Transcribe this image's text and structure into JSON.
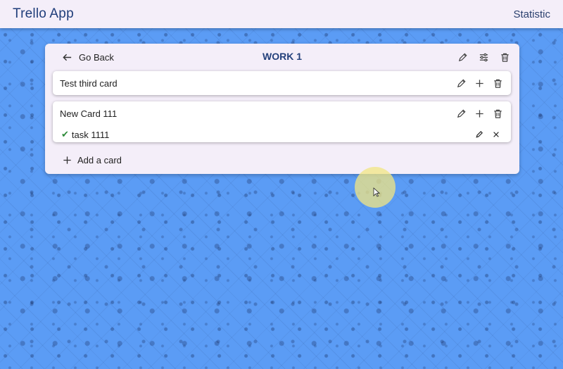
{
  "appbar": {
    "title": "Trello App",
    "statistic_label": "Statistic"
  },
  "board": {
    "back_label": "Go Back",
    "title": "WORK 1",
    "add_card_label": "Add a card"
  },
  "cards": [
    {
      "title": "Test third card",
      "tasks": []
    },
    {
      "title": "New Card 111",
      "tasks": [
        {
          "label": "task 1111",
          "done": true
        }
      ]
    }
  ],
  "icons": {
    "back": "arrow-left-icon",
    "edit": "pencil-icon",
    "settings": "sliders-icon",
    "delete": "trash-icon",
    "add": "plus-icon",
    "check": "check-icon",
    "close": "close-icon"
  },
  "colors": {
    "accent": "#1f3d7a",
    "surface": "#f4eef9",
    "background": "#5b9cf5",
    "check": "#2e8b3a"
  }
}
